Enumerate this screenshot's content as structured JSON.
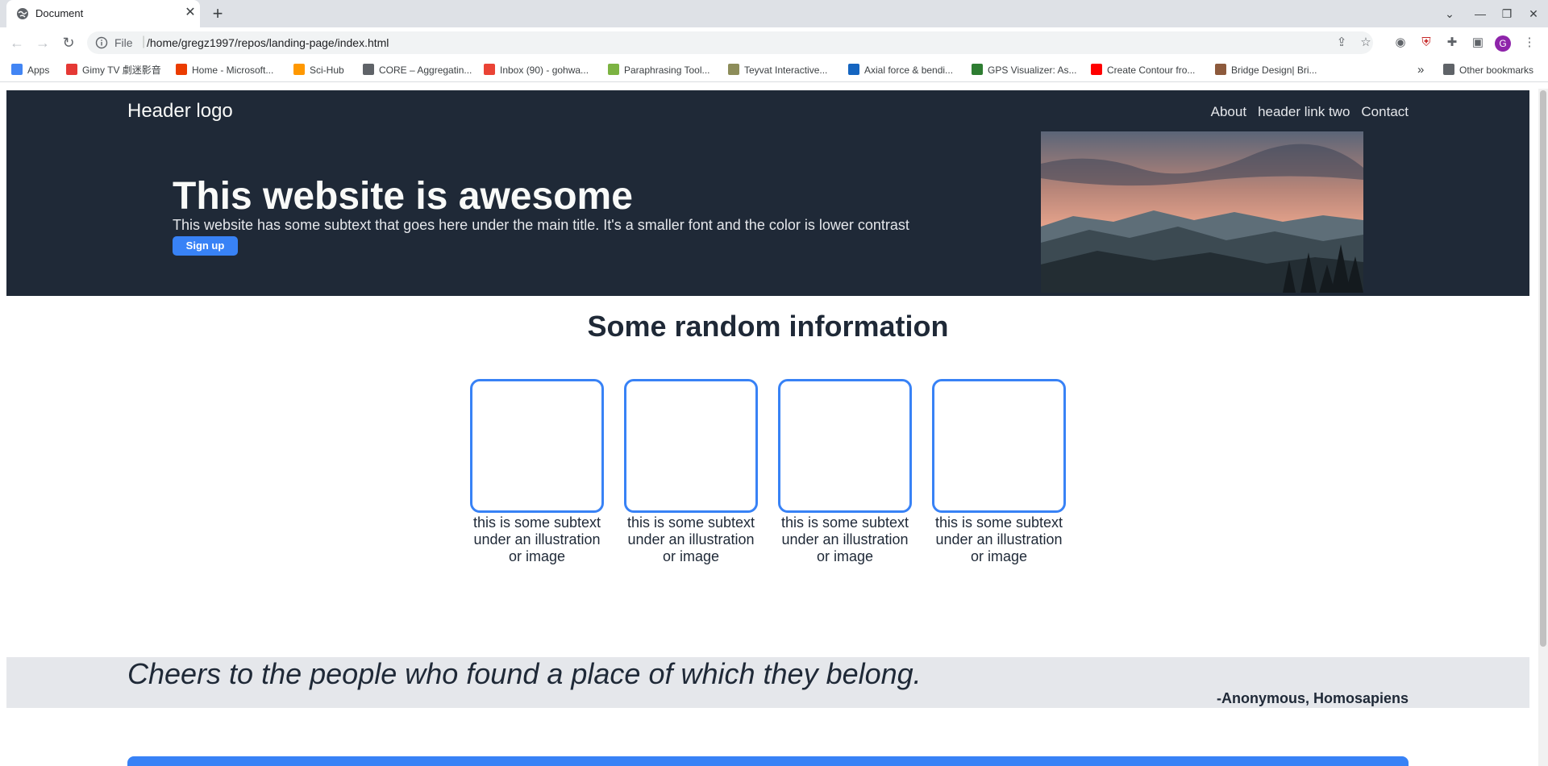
{
  "browser": {
    "tab": {
      "title": "Document",
      "close": "✕"
    },
    "new_tab": "+",
    "window_buttons": {
      "list": "⌄",
      "minimize": "—",
      "restore": "❐",
      "close": "✕"
    },
    "address": {
      "scheme": "File",
      "separator": "|",
      "url": "/home/gregz1997/repos/landing-page/index.html"
    },
    "bookmarks": [
      {
        "label": "Apps",
        "color": "#4285f4"
      },
      {
        "label": "Gimy TV 劇迷影音",
        "color": "#e53935"
      },
      {
        "label": "Home - Microsoft...",
        "color": "#eb3c00"
      },
      {
        "label": "Sci-Hub",
        "color": "#ff9800"
      },
      {
        "label": "CORE – Aggregatin...",
        "color": "#5f6368"
      },
      {
        "label": "Inbox (90) - gohwa...",
        "color": "#ea4335"
      },
      {
        "label": "Paraphrasing Tool...",
        "color": "#7cb342"
      },
      {
        "label": "Teyvat Interactive...",
        "color": "#8d8d5a"
      },
      {
        "label": "Axial force & bendi...",
        "color": "#1565c0"
      },
      {
        "label": "GPS Visualizer: As...",
        "color": "#2e7d32"
      },
      {
        "label": "Create Contour fro...",
        "color": "#ff0000"
      },
      {
        "label": "Bridge Design| Bri...",
        "color": "#8d5a3c"
      }
    ],
    "bookmarks_overflow": "»",
    "other_bookmarks": "Other bookmarks",
    "profile_initial": "G"
  },
  "page": {
    "header_logo": "Header logo",
    "nav_links": [
      "About",
      "header link two",
      "Contact"
    ],
    "hero_title": "This website is awesome",
    "hero_subtext": "This website has some subtext that goes here under the main title. It's a smaller font and the color is lower contrast",
    "signup_label": "Sign up",
    "info_title": "Some random information",
    "cards": [
      {
        "text": "this is some subtext under an illustration or image"
      },
      {
        "text": "this is some subtext under an illustration or image"
      },
      {
        "text": "this is some subtext under an illustration or image"
      },
      {
        "text": "this is some subtext under an illustration or image"
      }
    ],
    "quote": "Cheers to the people who found a place of which they belong.",
    "quote_author": "-Anonymous, Homosapiens"
  },
  "colors": {
    "hero_bg": "#1f2937",
    "accent": "#3882f6",
    "quote_bg": "#e5e7eb",
    "heading_text": "#1f2937"
  }
}
